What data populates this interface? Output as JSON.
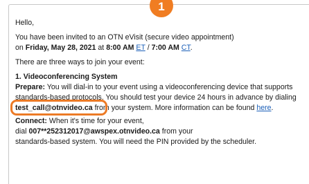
{
  "badge": {
    "number": "1",
    "color": "#f07d22"
  },
  "email": {
    "greeting": "Hello,",
    "invite_text": "You have been invited to an OTN eVisit (secure video appointment)",
    "on_word": "on",
    "date_text": "Friday, May 28, 2021",
    "at_word": "at",
    "time_et": "8:00 AM",
    "tz_et": "ET",
    "slash": "/",
    "time_ct": "7:00 AM",
    "tz_ct": "CT",
    "period": ".",
    "ways_text": "There are three ways to join your event:",
    "section_title": "1. Videoconferencing System",
    "prepare_label": "Prepare:",
    "prepare_text_a": "You will dial-in to your event using a videoconferencing device that supports standards-based protocols. You should test your device 24 hours in advance by dialing",
    "test_address": "test_call@otnvideo.ca",
    "prepare_text_b": "from your system. More information can be found",
    "here_link": "here",
    "connect_label": "Connect:",
    "connect_text_a": "When it's time for your event,",
    "dial_word": "dial",
    "dial_address": "007**252312017@awspex.otnvideo.ca",
    "connect_text_b": "from your",
    "connect_text_c": "standards-based system. You will need the PIN provided by the scheduler.",
    "link_color": "#1b5fb8",
    "highlight_color": "#ec7a25"
  }
}
